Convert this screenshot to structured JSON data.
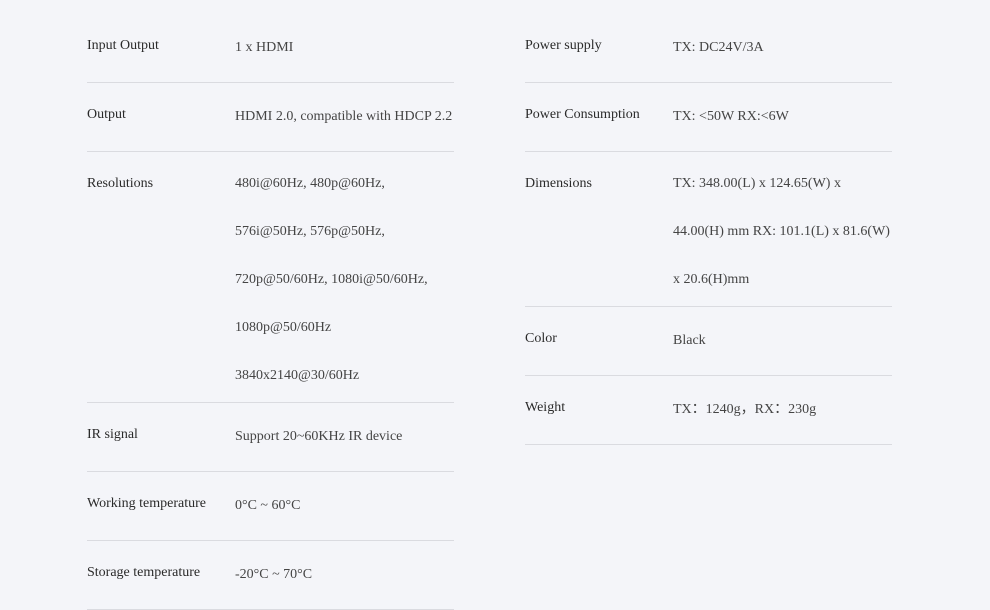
{
  "left": [
    {
      "label": "Input Output",
      "value": [
        "1 x HDMI"
      ]
    },
    {
      "label": "Output",
      "value": [
        "HDMI 2.0, compatible with HDCP 2.2"
      ]
    },
    {
      "label": "Resolutions",
      "value": [
        "480i@60Hz, 480p@60Hz,",
        "576i@50Hz, 576p@50Hz,",
        "720p@50/60Hz, 1080i@50/60Hz,",
        "1080p@50/60Hz",
        "3840x2140@30/60Hz"
      ]
    },
    {
      "label": "IR signal",
      "value": [
        "Support 20~60KHz IR device"
      ]
    },
    {
      "label": "Working temperature",
      "value": [
        "0°C ~ 60°C"
      ]
    },
    {
      "label": "Storage temperature",
      "value": [
        "-20°C ~ 70°C"
      ]
    }
  ],
  "right": [
    {
      "label": "Power supply",
      "value": [
        "TX: DC24V/3A"
      ]
    },
    {
      "label": "Power Consumption",
      "value": [
        "TX: <50W RX:<6W"
      ]
    },
    {
      "label": "Dimensions",
      "value": [
        "TX: 348.00(L) x 124.65(W) x",
        "44.00(H) mm RX: 101.1(L) x 81.6(W)",
        "x 20.6(H)mm"
      ]
    },
    {
      "label": "Color",
      "value": [
        "Black"
      ]
    },
    {
      "label": "Weight",
      "value": [
        "TX：1240g，RX：230g"
      ]
    }
  ]
}
